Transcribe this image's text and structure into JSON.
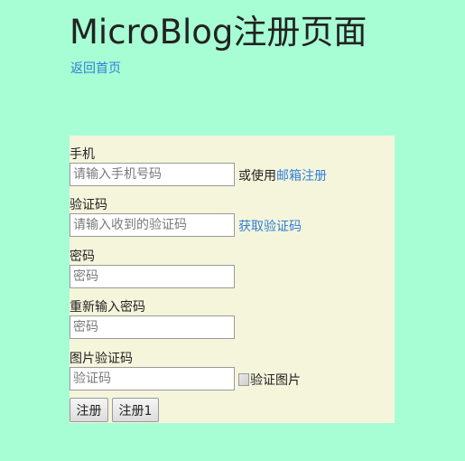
{
  "header": {
    "title": "MicroBlog注册页面",
    "home_link": "返回首页"
  },
  "form": {
    "phone": {
      "label": "手机",
      "placeholder": "请输入手机号码",
      "alt_prefix": "或使用",
      "alt_link": "邮箱注册"
    },
    "code": {
      "label": "验证码",
      "placeholder": "请输入收到的验证码",
      "get_code_link": "获取验证码"
    },
    "password": {
      "label": "密码",
      "placeholder": "密码"
    },
    "password_confirm": {
      "label": "重新输入密码",
      "placeholder": "密码"
    },
    "captcha": {
      "label": "图片验证码",
      "placeholder": "验证码",
      "image_alt": "验证图片"
    },
    "buttons": {
      "register": "注册",
      "register1": "注册1"
    }
  },
  "colors": {
    "background": "#a7fdd4",
    "panel": "#f5f5dc",
    "link": "#2f7fd6"
  }
}
